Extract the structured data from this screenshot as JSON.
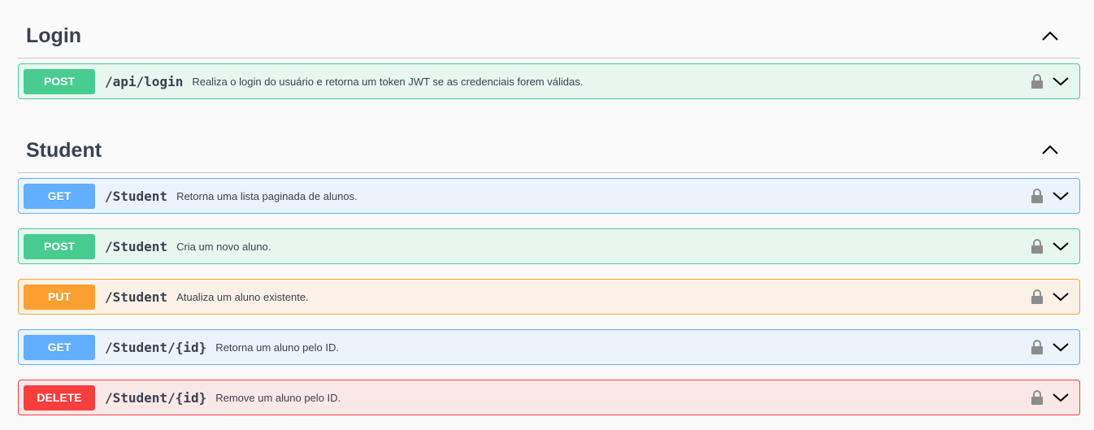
{
  "sections": [
    {
      "title": "Login",
      "toggle_icon": "chevron-up-icon",
      "operations": [
        {
          "method": "POST",
          "path": "/api/login",
          "summary": "Realiza o login do usuário e retorna um token JWT se as credenciais forem válidas."
        }
      ]
    },
    {
      "title": "Student",
      "toggle_icon": "chevron-up-icon",
      "operations": [
        {
          "method": "GET",
          "path": "/Student",
          "summary": "Retorna uma lista paginada de alunos."
        },
        {
          "method": "POST",
          "path": "/Student",
          "summary": "Cria um novo aluno."
        },
        {
          "method": "PUT",
          "path": "/Student",
          "summary": "Atualiza um aluno existente."
        },
        {
          "method": "GET",
          "path": "/Student/{id}",
          "summary": "Retorna um aluno pelo ID."
        },
        {
          "method": "DELETE",
          "path": "/Student/{id}",
          "summary": "Remove um aluno pelo ID."
        }
      ]
    }
  ],
  "icons": {
    "lock": "lock-icon",
    "expand": "chevron-down-icon"
  },
  "colors": {
    "get": "#61affe",
    "post": "#49cc90",
    "put": "#fca130",
    "delete": "#f93e3e",
    "text": "#3b4151"
  }
}
